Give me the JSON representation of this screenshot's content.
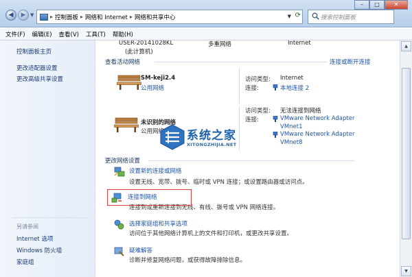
{
  "window": {
    "breadcrumbs": [
      "控制面板",
      "网络和 Internet",
      "网络和共享中心"
    ],
    "search_placeholder": "搜索控制面板",
    "buttons": {
      "minimize": "–",
      "maximize": "□",
      "close": "✕"
    }
  },
  "menu": [
    "文件(F)",
    "编辑(E)",
    "查看(V)",
    "工具(T)",
    "帮助(H)"
  ],
  "sidebar": {
    "links": [
      "控制面板主页",
      "更改适配器设置",
      "更改高级共享设置"
    ],
    "see_also_title": "另请参阅",
    "see_also": [
      "Internet 选项",
      "Windows 防火墙",
      "家庭组"
    ]
  },
  "main": {
    "top_row": {
      "computer": "USER-20141028KL",
      "computer_sub": "(此计算机)",
      "network": "多重网络",
      "internet": "Internet"
    },
    "active_title": "查看活动网络",
    "connect_or_disconnect": "连接或断开连接",
    "networks": [
      {
        "name": "SM-keji2.4",
        "type": "公用网络",
        "access_label": "访问类型:",
        "access_value": "Internet",
        "conn_label": "连接:",
        "connections": [
          "本地连接 2"
        ]
      },
      {
        "name": "未识别的网络",
        "type": "公用网络",
        "access_label": "访问类型:",
        "access_value": "无法连接到网络",
        "conn_label": "连接:",
        "connections": [
          "VMware Network Adapter VMnet1",
          "VMware Network Adapter VMnet8"
        ]
      }
    ],
    "change_title": "更改网络设置",
    "tasks": [
      {
        "title": "设置新的连接或网络",
        "desc": "设置无线、宽带、拨号、临时或 VPN 连接；或设置路由器或访问点。",
        "icon": "network-setup-icon"
      },
      {
        "title": "连接到网络",
        "desc": "连接到或重新连接到无线、有线、拨号或 VPN 网络连接。",
        "icon": "connect-network-icon"
      },
      {
        "title": "选择家庭组和共享选项",
        "desc": "访问位于其他网络计算机上的文件和打印机，或更改共享设置。",
        "icon": "homegroup-icon"
      },
      {
        "title": "疑难解答",
        "desc": "诊断并修复网络问题，或获得故障排除信息。",
        "icon": "troubleshoot-icon"
      }
    ]
  },
  "watermark": {
    "title": "系统之家",
    "subtitle": "XITONGZHIJIA.NET"
  },
  "colors": {
    "link": "#1f55a6",
    "highlight": "#e23b3b",
    "heading": "#1e3a66"
  }
}
